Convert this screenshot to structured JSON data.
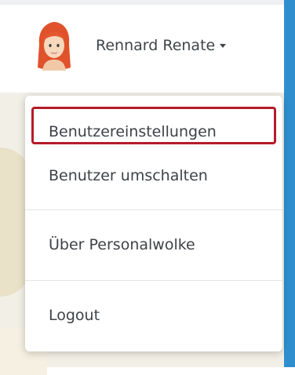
{
  "user": {
    "name": "Rennard Renate",
    "avatar_icon": "female-avatar-icon"
  },
  "menu": {
    "items": [
      {
        "label": "Benutzereinstellungen"
      },
      {
        "label": "Benutzer umschalten"
      },
      {
        "label": "Über Personalwolke"
      },
      {
        "label": "Logout"
      }
    ]
  },
  "colors": {
    "highlight": "#b51c2a",
    "accent": "#2f8fce",
    "text": "#3d4247"
  }
}
